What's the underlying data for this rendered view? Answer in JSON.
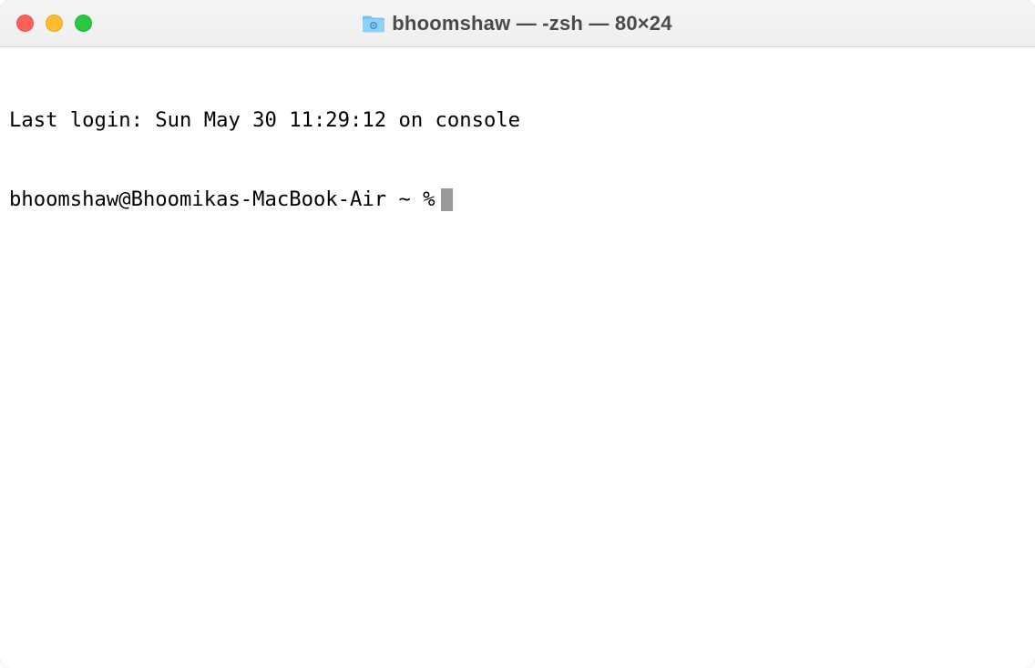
{
  "titlebar": {
    "title": "bhoomshaw — -zsh — 80×24"
  },
  "terminal": {
    "last_login_line": "Last login: Sun May 30 11:29:12 on console",
    "prompt": "bhoomshaw@Bhoomikas-MacBook-Air ~ %"
  }
}
